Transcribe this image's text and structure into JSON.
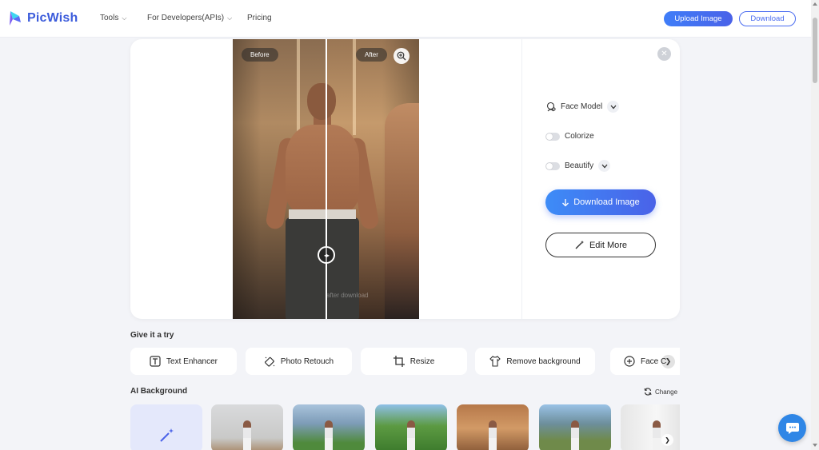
{
  "header": {
    "logo_text": "PicWish",
    "nav": [
      {
        "label": "Tools",
        "has_dropdown": true
      },
      {
        "label": "For Developers(APIs)",
        "has_dropdown": true
      },
      {
        "label": "Pricing",
        "has_dropdown": false
      }
    ],
    "upload_label": "Upload Image",
    "download_label": "Download"
  },
  "preview": {
    "before_label": "Before",
    "after_label": "After",
    "watermark_text": "after download",
    "zoom_icon": "zoom-in-icon",
    "handle_icon": "compare-handle-icon"
  },
  "options": {
    "face_model_label": "Face Model",
    "colorize_label": "Colorize",
    "colorize_on": false,
    "beautify_label": "Beautify",
    "beautify_on": false,
    "download_image_label": "Download Image",
    "edit_more_label": "Edit More"
  },
  "give_it_a_try": {
    "title": "Give it a try",
    "tools": [
      {
        "label": "Text Enhancer",
        "icon": "text-enhancer-icon"
      },
      {
        "label": "Photo Retouch",
        "icon": "photo-retouch-icon"
      },
      {
        "label": "Resize",
        "icon": "crop-icon"
      },
      {
        "label": "Remove background",
        "icon": "shirt-icon"
      },
      {
        "label": "Face C",
        "icon": "add-circle-icon"
      }
    ]
  },
  "ai_background": {
    "title": "AI Background",
    "change_label": "Change",
    "thumbnails": [
      "magic-wand-tile",
      "indoor-room",
      "city-buildings",
      "park-trees",
      "wooden-cabin",
      "mountain-lake",
      "white-curtains"
    ]
  },
  "colors": {
    "brand": "#3b5bdb",
    "accent_gradient_start": "#3d8cf7",
    "accent_gradient_end": "#4a62e8",
    "page_bg": "#f3f4f8"
  }
}
